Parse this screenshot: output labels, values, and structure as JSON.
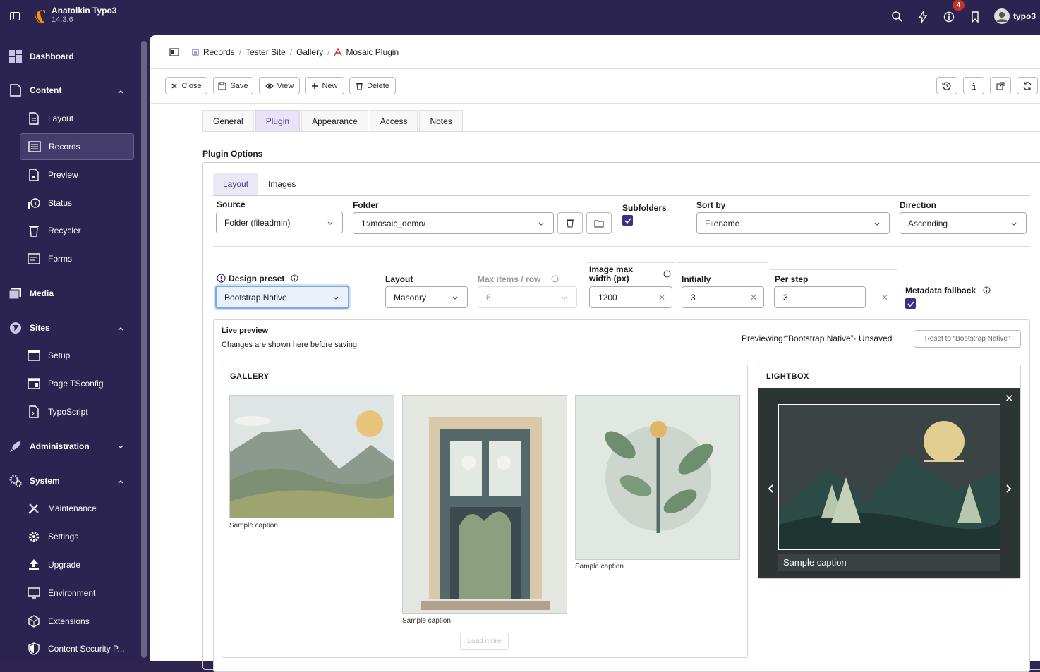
{
  "app": {
    "name": "Anatolkin Typo3",
    "version": "14.3.6",
    "notification_count": "4",
    "user": "typo3_"
  },
  "sidebar": {
    "items": [
      {
        "label": "Dashboard"
      },
      {
        "label": "Content"
      },
      {
        "label": "Layout"
      },
      {
        "label": "Records"
      },
      {
        "label": "Preview"
      },
      {
        "label": "Status"
      },
      {
        "label": "Recycler"
      },
      {
        "label": "Forms"
      },
      {
        "label": "Media"
      },
      {
        "label": "Sites"
      },
      {
        "label": "Setup"
      },
      {
        "label": "Page TSconfig"
      },
      {
        "label": "TypoScript"
      },
      {
        "label": "Administration"
      },
      {
        "label": "System"
      },
      {
        "label": "Maintenance"
      },
      {
        "label": "Settings"
      },
      {
        "label": "Upgrade"
      },
      {
        "label": "Environment"
      },
      {
        "label": "Extensions"
      },
      {
        "label": "Content Security P..."
      }
    ]
  },
  "breadcrumb": [
    "Records",
    "Tester Site",
    "Gallery",
    "Mosaic Plugin"
  ],
  "toolbar": {
    "close": "Close",
    "save": "Save",
    "view": "View",
    "new": "New",
    "delete": "Delete"
  },
  "tabs": [
    "General",
    "Plugin",
    "Appearance",
    "Access",
    "Notes"
  ],
  "section_title": "Plugin Options",
  "inner_tabs": [
    "Layout",
    "Images"
  ],
  "fields": {
    "source": {
      "label": "Source",
      "value": "Folder (fileadmin)"
    },
    "folder": {
      "label": "Folder",
      "value": "1:/mosaic_demo/"
    },
    "subfolders": {
      "label": "Subfolders",
      "checked": true
    },
    "sort_by": {
      "label": "Sort by",
      "value": "Filename"
    },
    "direction": {
      "label": "Direction",
      "value": "Ascending"
    },
    "design_preset": {
      "label": "Design preset",
      "value": "Bootstrap Native"
    },
    "layout": {
      "label": "Layout",
      "value": "Masonry"
    },
    "max_items": {
      "label": "Max items / row",
      "value": "6"
    },
    "image_max_width": {
      "label": "Image max width (px)",
      "value": "1200"
    },
    "initially": {
      "label": "Initially",
      "value": "3"
    },
    "per_step": {
      "label": "Per step",
      "value": "3"
    },
    "metadata_fallback": {
      "label": "Metadata fallback",
      "checked": true
    }
  },
  "preview": {
    "title": "Live preview",
    "subtitle": "Changes are shown here before saving.",
    "status": "Previewing:“Bootstrap Native”· Unsaved",
    "reset": "Reset to “Bootstrap Native”",
    "gallery_title": "GALLERY",
    "lightbox_title": "LIGHTBOX",
    "captions": [
      "Sample caption",
      "Sample caption",
      "Sample caption"
    ],
    "lightbox_caption": "Sample caption",
    "load_more": "Load more"
  },
  "colors": {
    "sidebar": "#2b2350",
    "accent": "#3d2f89",
    "active_tab": "#e8e4f5"
  }
}
